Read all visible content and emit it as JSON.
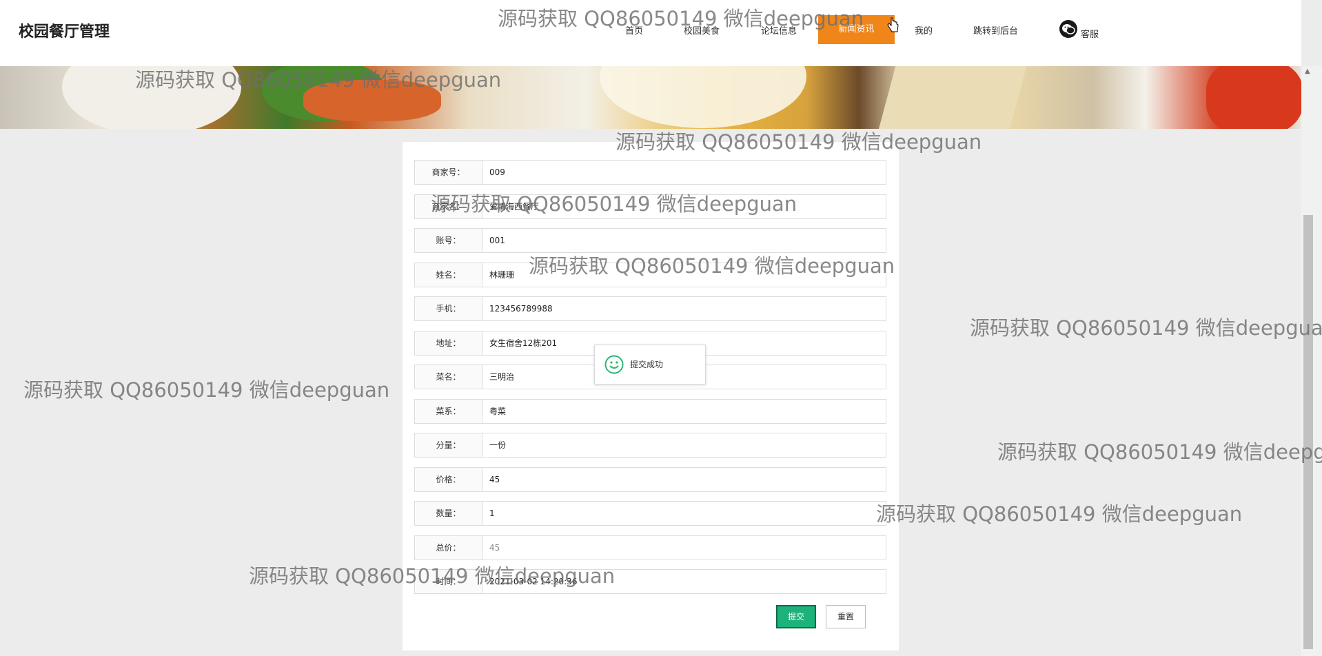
{
  "header": {
    "brand": "校园餐厅管理",
    "nav": [
      "首页",
      "校园美食",
      "论坛信息",
      "新闻资讯",
      "我的",
      "跳转到后台"
    ],
    "service_label": "客服"
  },
  "form": {
    "rows": [
      {
        "label": "商家号：",
        "value": "009"
      },
      {
        "label": "商家名：",
        "value": "爱情海西餐厅"
      },
      {
        "label": "账号：",
        "value": "001"
      },
      {
        "label": "姓名：",
        "value": "林珊珊"
      },
      {
        "label": "手机：",
        "value": "123456789988"
      },
      {
        "label": "地址：",
        "value": "女生宿舍12栋201"
      },
      {
        "label": "菜名：",
        "value": "三明治"
      },
      {
        "label": "菜系：",
        "value": "粤菜"
      },
      {
        "label": "分量：",
        "value": "一份"
      },
      {
        "label": "价格：",
        "value": "45"
      },
      {
        "label": "数量：",
        "value": "1"
      },
      {
        "label": "总价：",
        "value": "45"
      },
      {
        "label": "时间：",
        "value": "2021-03-02 14:20:36"
      }
    ],
    "submit_label": "提交",
    "reset_label": "重置"
  },
  "toast": {
    "message": "提交成功"
  },
  "watermark_text": "源码获取 QQ86050149 微信deepguan",
  "colors": {
    "accent": "#f08519",
    "submit": "#1db27a",
    "toast_icon": "#2bb673"
  }
}
